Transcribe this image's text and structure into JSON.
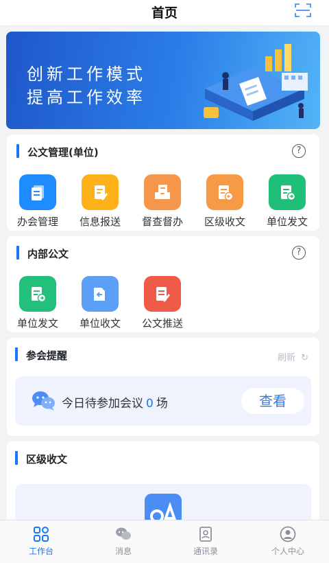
{
  "header": {
    "title": "首页",
    "scan_icon": "scan-icon"
  },
  "banner": {
    "line1": "创新工作模式",
    "line2": "提高工作效率"
  },
  "sections": {
    "official_docs": {
      "title": "公文管理(单位)",
      "items": [
        {
          "label": "办会管理",
          "icon": "document-stack-icon",
          "color": "#1e8cff"
        },
        {
          "label": "信息报送",
          "icon": "document-edit-icon",
          "color": "#ffb119"
        },
        {
          "label": "督查督办",
          "icon": "inbox-tray-icon",
          "color": "#f5964a"
        },
        {
          "label": "区级收文",
          "icon": "document-receive-icon",
          "color": "#f79a45"
        },
        {
          "label": "单位发文",
          "icon": "document-send-icon",
          "color": "#1fbf78"
        }
      ]
    },
    "internal_docs": {
      "title": "内部公文",
      "items": [
        {
          "label": "单位发文",
          "icon": "document-send-icon",
          "color": "#22c07a"
        },
        {
          "label": "单位收文",
          "icon": "folder-receive-icon",
          "color": "#5b9ff7"
        },
        {
          "label": "公文推送",
          "icon": "document-push-icon",
          "color": "#f05a48"
        }
      ]
    },
    "meeting_reminder": {
      "title": "参会提醒",
      "refresh_label": "刷新",
      "text_before": "今日待参加会议",
      "count": "0",
      "text_after": "场",
      "view_button": "查看"
    },
    "district_docs": {
      "title": "区级收文"
    }
  },
  "tabbar": {
    "items": [
      {
        "label": "工作台",
        "icon": "grid-apps-icon",
        "active": true
      },
      {
        "label": "消息",
        "icon": "chat-bubbles-icon",
        "active": false
      },
      {
        "label": "通讯录",
        "icon": "contacts-book-icon",
        "active": false
      },
      {
        "label": "个人中心",
        "icon": "user-profile-icon",
        "active": false
      }
    ]
  },
  "colors": {
    "accent": "#1677ff",
    "background": "#f2f3f5"
  }
}
